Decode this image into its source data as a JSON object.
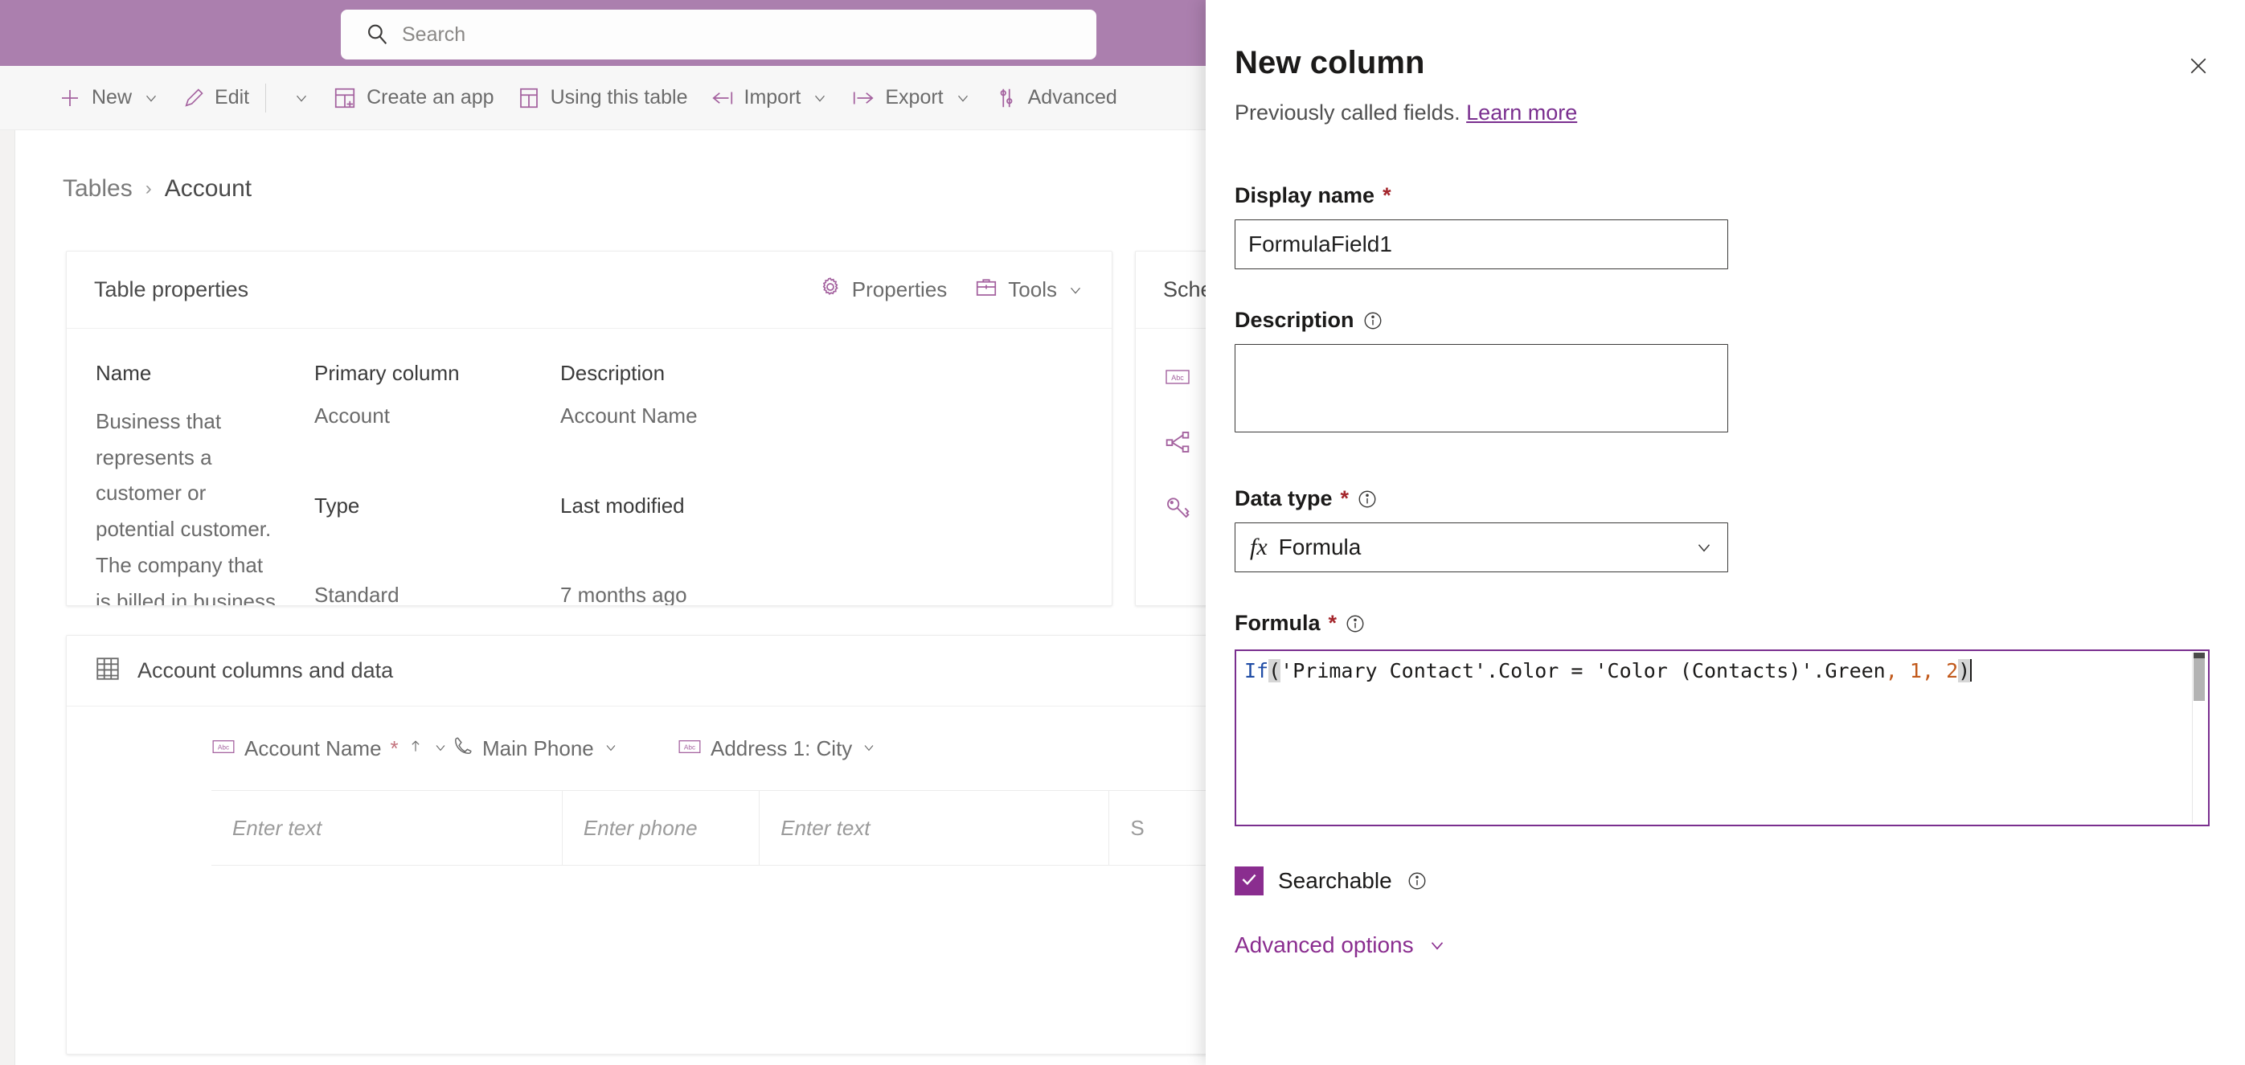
{
  "topbar": {
    "search": {
      "placeholder": "Search",
      "icon": "search-icon"
    }
  },
  "commandbar": {
    "items": [
      {
        "label": "New",
        "icon": "plus-icon",
        "chevron": true,
        "divider": false
      },
      {
        "label": "Edit",
        "icon": "pencil-icon",
        "chevron": true,
        "divider": true
      },
      {
        "label": "Create an app",
        "icon": "app-grid-icon",
        "chevron": false,
        "divider": false
      },
      {
        "label": "Using this table",
        "icon": "table-icon",
        "chevron": false,
        "divider": false
      },
      {
        "label": "Import",
        "icon": "import-arrow-icon",
        "chevron": true,
        "divider": false
      },
      {
        "label": "Export",
        "icon": "export-arrow-icon",
        "chevron": true,
        "divider": false
      },
      {
        "label": "Advanced",
        "icon": "settings-sliders-icon",
        "chevron": false,
        "divider": false
      }
    ]
  },
  "breadcrumb": {
    "root": "Tables",
    "separator": "›",
    "current": "Account"
  },
  "table_properties": {
    "title": "Table properties",
    "actions": [
      {
        "label": "Properties",
        "icon": "gear-icon"
      },
      {
        "label": "Tools",
        "icon": "toolbox-icon",
        "chevron": true
      }
    ],
    "headers": {
      "name": "Name",
      "primary_column": "Primary column",
      "description": "Description"
    },
    "values": {
      "name": "Account",
      "primary_column": "Account Name",
      "description": "Business that represents a customer or potential customer. The company that is billed in business transactions.",
      "type_label": "Type",
      "last_modified_label": "Last modified",
      "type": "Standard",
      "last_modified": "7 months ago"
    }
  },
  "schema_card": {
    "title": "Schema",
    "rows": [
      {
        "icon": "abc-icon"
      },
      {
        "icon": "relationships-icon"
      },
      {
        "icon": "key-icon"
      }
    ]
  },
  "columns_card": {
    "title": "Account columns and data",
    "icon": "grid-table-icon",
    "headers": [
      {
        "label": "Account Name",
        "icon": "abc-icon",
        "required": true,
        "sorted": true,
        "chevron": true
      },
      {
        "label": "Main Phone",
        "icon": "phone-icon",
        "required": false,
        "sorted": false,
        "chevron": true
      },
      {
        "label": "Address 1: City",
        "icon": "abc-icon",
        "required": false,
        "sorted": false,
        "chevron": true
      }
    ],
    "row_placeholders": [
      "Enter text",
      "Enter phone",
      "Enter text",
      "S"
    ]
  },
  "panel": {
    "title": "New column",
    "subtitle_text": "Previously called fields.",
    "subtitle_link": "Learn more",
    "close_icon": "close-icon",
    "display_name": {
      "label": "Display name",
      "required_mark": "*",
      "value": "FormulaField1",
      "placeholder": ""
    },
    "description": {
      "label": "Description",
      "info_icon": "info-icon",
      "value": "",
      "placeholder": ""
    },
    "data_type": {
      "label": "Data type",
      "required_mark": "*",
      "info_icon": "info-icon",
      "fx_glyph": "fx",
      "value": "Formula",
      "chevron_icon": "chevron-down-icon"
    },
    "formula": {
      "label": "Formula",
      "required_mark": "*",
      "info_icon": "info-icon",
      "text": "If('Primary Contact'.Color = 'Color (Contacts)'.Green, 1, 2)",
      "tokens": [
        {
          "t": "If",
          "c": "tk-fn"
        },
        {
          "t": "(",
          "c": "tk-brk"
        },
        {
          "t": "'Primary Contact'.Color = 'Color (Contacts)'.Green",
          "c": "tk-plain"
        },
        {
          "t": ",",
          "c": "tk-comma"
        },
        {
          "t": " ",
          "c": "tk-plain"
        },
        {
          "t": "1",
          "c": "tk-num"
        },
        {
          "t": ",",
          "c": "tk-comma"
        },
        {
          "t": " ",
          "c": "tk-plain"
        },
        {
          "t": "2",
          "c": "tk-num"
        },
        {
          "t": ")",
          "c": "tk-brk"
        }
      ]
    },
    "searchable": {
      "label": "Searchable",
      "checked": true,
      "check_glyph": "✓",
      "info_icon": "info-icon"
    },
    "advanced_options": {
      "label": "Advanced options",
      "chevron_icon": "chevron-down-icon"
    }
  },
  "colors": {
    "brand_purple": "#8a2d8f",
    "topbar_purple": "#ab7fae",
    "icon_purple": "#a4629f",
    "required_red": "#a4262c",
    "formula_border": "#7a2f8f",
    "code_keyword_blue": "#1f4ca5",
    "code_number_orange": "#c25a1c"
  }
}
